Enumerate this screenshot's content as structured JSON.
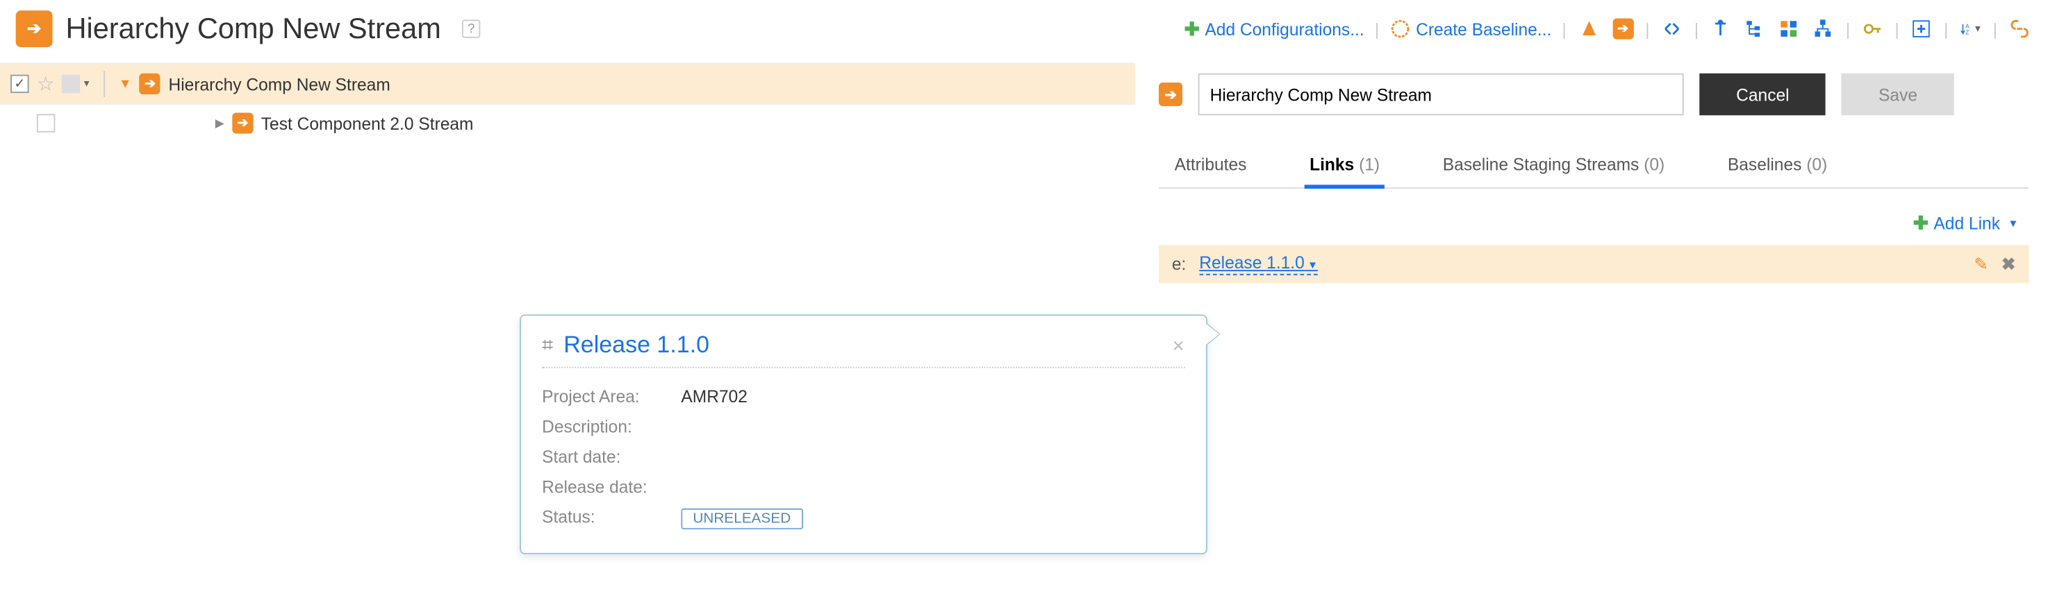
{
  "header": {
    "title": "Hierarchy Comp New Stream",
    "add_configurations": "Add Configurations...",
    "create_baseline": "Create Baseline..."
  },
  "tree": {
    "root_label": "Hierarchy Comp New Stream",
    "child_label": "Test Component 2.0 Stream"
  },
  "edit": {
    "name_value": "Hierarchy Comp New Stream",
    "cancel": "Cancel",
    "save": "Save"
  },
  "tabs": {
    "attributes": "Attributes",
    "links": "Links",
    "links_count": "(1)",
    "bss": "Baseline Staging Streams",
    "bss_count": "(0)",
    "baselines": "Baselines",
    "baselines_count": "(0)"
  },
  "links_section": {
    "add_link": "Add Link",
    "row_label_fragment": "e:",
    "row_link": "Release 1.1.0"
  },
  "popover": {
    "title": "Release 1.1.0",
    "project_area_k": "Project Area:",
    "project_area_v": "AMR702",
    "description_k": "Description:",
    "description_v": "",
    "start_date_k": "Start date:",
    "start_date_v": "",
    "release_date_k": "Release date:",
    "release_date_v": "",
    "status_k": "Status:",
    "status_v": "UNRELEASED"
  }
}
